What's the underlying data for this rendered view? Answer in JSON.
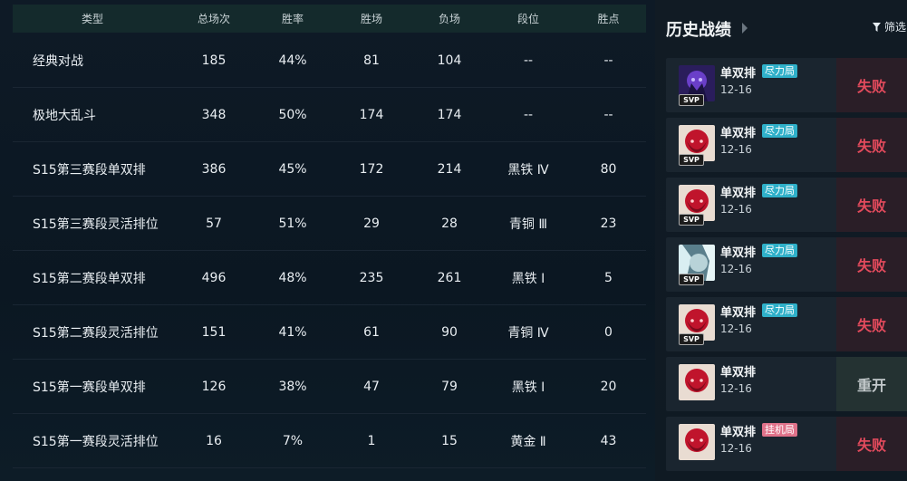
{
  "stats": {
    "headers": [
      "类型",
      "总场次",
      "胜率",
      "胜场",
      "负场",
      "段位",
      "胜点"
    ],
    "rows": [
      [
        "经典对战",
        "185",
        "44%",
        "81",
        "104",
        "--",
        "--"
      ],
      [
        "极地大乱斗",
        "348",
        "50%",
        "174",
        "174",
        "--",
        "--"
      ],
      [
        "S15第三赛段单双排",
        "386",
        "45%",
        "172",
        "214",
        "黑铁 Ⅳ",
        "80"
      ],
      [
        "S15第三赛段灵活排位",
        "57",
        "51%",
        "29",
        "28",
        "青铜 Ⅲ",
        "23"
      ],
      [
        "S15第二赛段单双排",
        "496",
        "48%",
        "235",
        "261",
        "黑铁 Ⅰ",
        "5"
      ],
      [
        "S15第二赛段灵活排位",
        "151",
        "41%",
        "61",
        "90",
        "青铜 Ⅳ",
        "0"
      ],
      [
        "S15第一赛段单双排",
        "126",
        "38%",
        "47",
        "79",
        "黑铁 Ⅰ",
        "20"
      ],
      [
        "S15第一赛段灵活排位",
        "16",
        "7%",
        "1",
        "15",
        "黄金 Ⅱ",
        "43"
      ]
    ]
  },
  "history": {
    "title": "历史战绩",
    "filter_label": "筛选",
    "matches": [
      {
        "mode": "单双排",
        "tag": "尽力局",
        "tag_color": "blue",
        "date": "12-16",
        "result": "失败",
        "result_type": "lose",
        "svp": "SVP",
        "avatar": "purple-champion-icon"
      },
      {
        "mode": "单双排",
        "tag": "尽力局",
        "tag_color": "blue",
        "date": "12-16",
        "result": "失败",
        "result_type": "lose",
        "svp": "SVP",
        "avatar": "red-champion-icon"
      },
      {
        "mode": "单双排",
        "tag": "尽力局",
        "tag_color": "blue",
        "date": "12-16",
        "result": "失败",
        "result_type": "lose",
        "svp": "SVP",
        "avatar": "red-champion-icon"
      },
      {
        "mode": "单双排",
        "tag": "尽力局",
        "tag_color": "blue",
        "date": "12-16",
        "result": "失败",
        "result_type": "lose",
        "svp": "SVP",
        "avatar": "pale-champion-icon"
      },
      {
        "mode": "单双排",
        "tag": "尽力局",
        "tag_color": "blue",
        "date": "12-16",
        "result": "失败",
        "result_type": "lose",
        "svp": "SVP",
        "avatar": "red-champion-icon"
      },
      {
        "mode": "单双排",
        "tag": "",
        "tag_color": "",
        "date": "12-16",
        "result": "重开",
        "result_type": "remake",
        "svp": "",
        "avatar": "red-champion-icon"
      },
      {
        "mode": "单双排",
        "tag": "挂机局",
        "tag_color": "pink",
        "date": "12-16",
        "result": "失败",
        "result_type": "lose",
        "svp": "",
        "avatar": "red-champion-icon"
      }
    ]
  },
  "colors": {
    "lose": "#e24a5c",
    "tag_blue": "#2fb0c9",
    "tag_pink": "#e0728a",
    "header_bg": "#142a2c"
  }
}
